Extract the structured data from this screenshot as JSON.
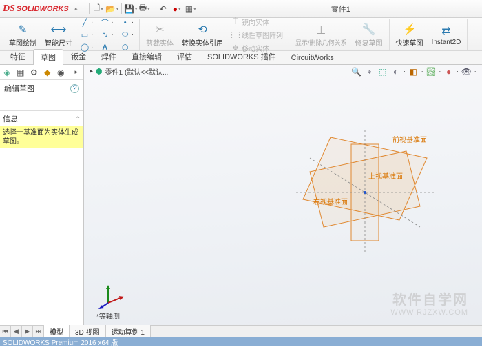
{
  "title": "零件1",
  "titlebar_icons": [
    "new",
    "open",
    "save",
    "print",
    "undo",
    "redo",
    "select",
    "settings"
  ],
  "ribbon": {
    "sketch": "草图绘制",
    "dim": "智能尺寸",
    "convert": "转换实体引用",
    "trim": "剪裁实体",
    "offset": "镜向实体",
    "mirror": "线性草图阵列",
    "display": "显示/删除几何关系",
    "repair": "修复草图",
    "quick": "快速草图",
    "instant": "Instant2D"
  },
  "tabs": [
    "特征",
    "草图",
    "钣金",
    "焊件",
    "直接编辑",
    "评估",
    "SOLIDWORKS 插件",
    "CircuitWorks"
  ],
  "active_tab": 1,
  "left": {
    "title": "编辑草图",
    "info_label": "信息",
    "info_text": "选择一基准面为实体生成草图。"
  },
  "breadcrumb": "零件1 (默认<<默认...",
  "planes": {
    "front": "前视基准面",
    "top": "上视基准面",
    "right": "右视基准面"
  },
  "triad_label": "*等轴测",
  "watermark": {
    "line1": "软件自学网",
    "line2": "WWW.RJZXW.COM"
  },
  "bottom_tabs": [
    "模型",
    "3D 视图",
    "运动算例 1"
  ],
  "status": "SOLIDWORKS Premium 2016 x64 版"
}
